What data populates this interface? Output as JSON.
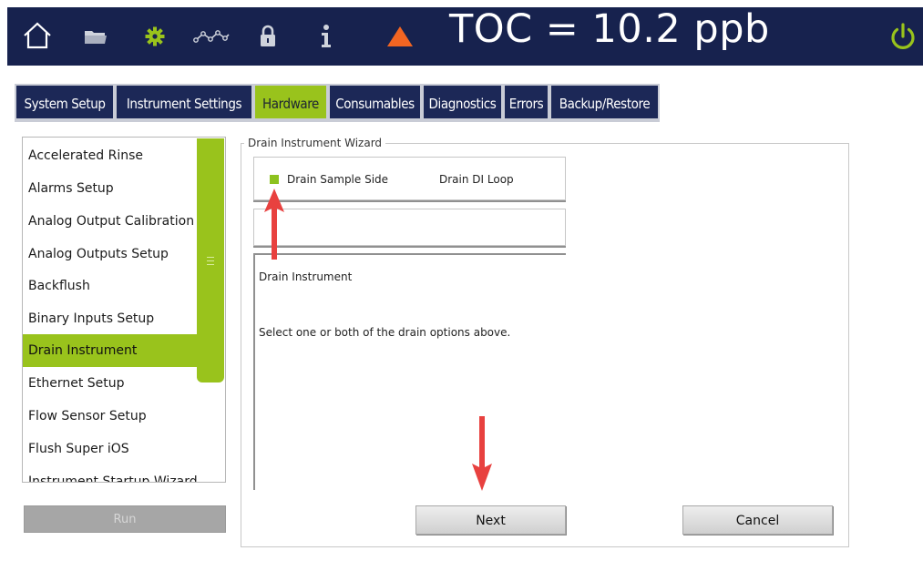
{
  "header": {
    "title": "TOC = 10.2 ppb",
    "icons": [
      "home-icon",
      "folder-icon",
      "gear-icon",
      "graph-icon",
      "lock-icon",
      "info-icon",
      "warning-icon",
      "power-icon"
    ],
    "colors": {
      "bar": "#17224e",
      "accent_green": "#99c31c",
      "warning": "#f26522"
    }
  },
  "tabs": [
    {
      "label": "System Setup",
      "active": false
    },
    {
      "label": "Instrument Settings",
      "active": false
    },
    {
      "label": "Hardware",
      "active": true
    },
    {
      "label": "Consumables",
      "active": false
    },
    {
      "label": "Diagnostics",
      "active": false
    },
    {
      "label": "Errors",
      "active": false
    },
    {
      "label": "Backup/Restore",
      "active": false
    }
  ],
  "menu": {
    "items": [
      "Accelerated Rinse",
      "Alarms Setup",
      "Analog Output Calibration",
      "Analog Outputs Setup",
      "Backflush",
      "Binary Inputs Setup",
      "Drain Instrument",
      "Ethernet Setup",
      "Flow Sensor Setup",
      "Flush Super iOS",
      "Instrument Startup Wizard"
    ],
    "selected": "Drain Instrument",
    "run_label": "Run"
  },
  "wizard": {
    "group_title": "Drain Instrument Wizard",
    "option_a": "Drain Sample Side",
    "option_b": "Drain DI Loop",
    "info_title": "Drain Instrument",
    "info_text": "Select one or both of the drain options above.",
    "next_label": "Next",
    "cancel_label": "Cancel"
  }
}
